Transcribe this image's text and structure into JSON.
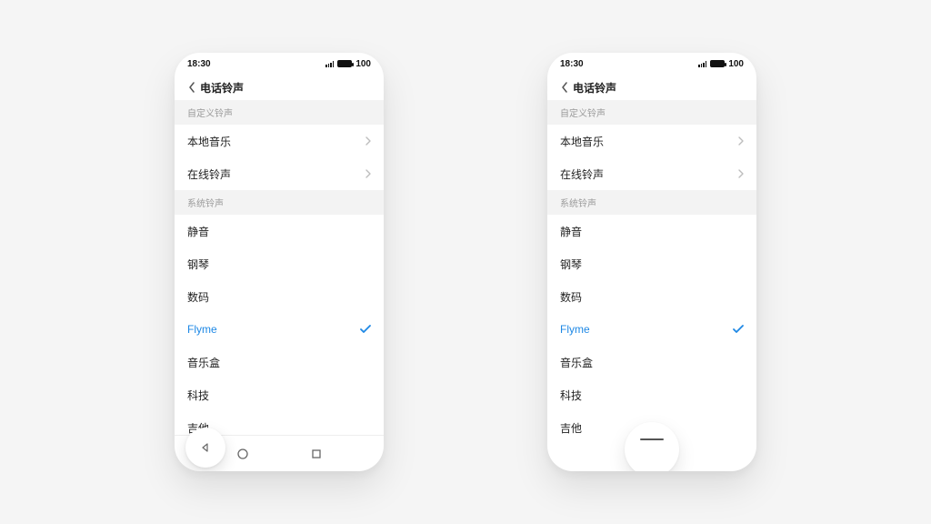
{
  "status": {
    "time": "18:30",
    "battery": "100"
  },
  "header": {
    "title": "电话铃声"
  },
  "sections": {
    "custom_label": "自定义铃声",
    "system_label": "系统铃声"
  },
  "custom_items": [
    {
      "label": "本地音乐"
    },
    {
      "label": "在线铃声"
    }
  ],
  "system_items": [
    {
      "label": "静音",
      "selected": false
    },
    {
      "label": "钢琴",
      "selected": false
    },
    {
      "label": "数码",
      "selected": false
    },
    {
      "label": "Flyme",
      "selected": true
    },
    {
      "label": "音乐盒",
      "selected": false
    },
    {
      "label": "科技",
      "selected": false
    },
    {
      "label": "吉他",
      "selected": false
    }
  ]
}
